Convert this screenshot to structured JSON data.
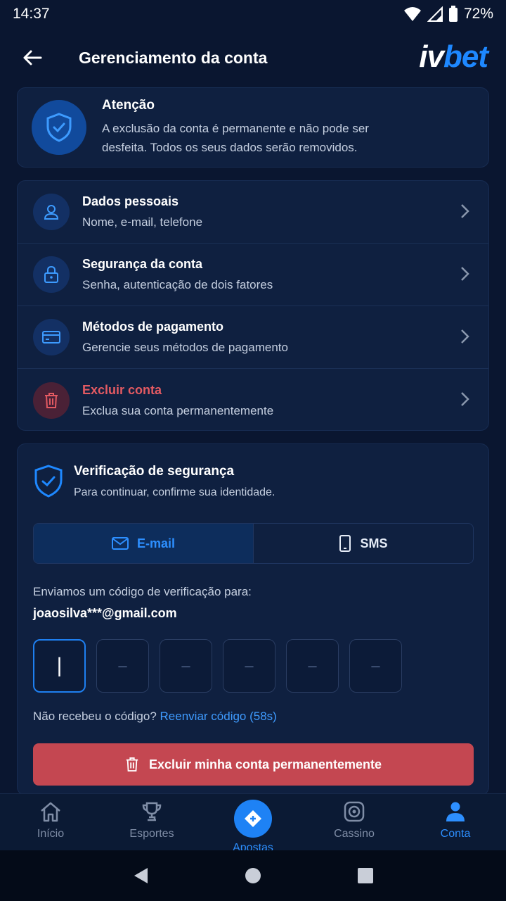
{
  "status_bar": {
    "time": "14:37",
    "battery": "72%"
  },
  "header": {
    "title": "Gerenciamento da conta",
    "logo_iv": "iv",
    "logo_bet": "bet"
  },
  "warning": {
    "title": "Atenção",
    "line1": "A exclusão da conta é permanente e não pode ser",
    "line2": "desfeita. Todos os seus dados serão removidos."
  },
  "menu": [
    {
      "title": "Dados pessoais",
      "subtitle": "Nome, e-mail, telefone",
      "icon": "user-icon"
    },
    {
      "title": "Segurança da conta",
      "subtitle": "Senha, autenticação de dois fatores",
      "icon": "lock-icon"
    },
    {
      "title": "Métodos de pagamento",
      "subtitle": "Gerencie seus métodos de pagamento",
      "icon": "card-icon"
    },
    {
      "title": "Excluir conta",
      "subtitle": "Exclua sua conta permanentemente",
      "icon": "trash-icon"
    }
  ],
  "verification": {
    "title": "Verificação de segurança",
    "subtitle": "Para continuar, confirme sua identidade.",
    "tabs": {
      "email": "E-mail",
      "sms": "SMS"
    },
    "sent_label": "Enviamos um código de verificação para:",
    "email": "joaosilva***@gmail.com",
    "code_placeholder": "–",
    "resend_prefix": "Não recebeu o código?",
    "resend_link": "Reenviar código (58s)",
    "delete_button": "Excluir minha conta permanentemente"
  },
  "bottom_nav": [
    {
      "label": "Início",
      "icon": "home-icon"
    },
    {
      "label": "Esportes",
      "icon": "trophy-icon"
    },
    {
      "label": "Apostas",
      "icon": "ticket-icon"
    },
    {
      "label": "Cassino",
      "icon": "casino-icon"
    },
    {
      "label": "Conta",
      "icon": "person-icon"
    }
  ],
  "colors": {
    "accent": "#1e88ff",
    "danger": "#c44751",
    "background": "#0a1630"
  }
}
